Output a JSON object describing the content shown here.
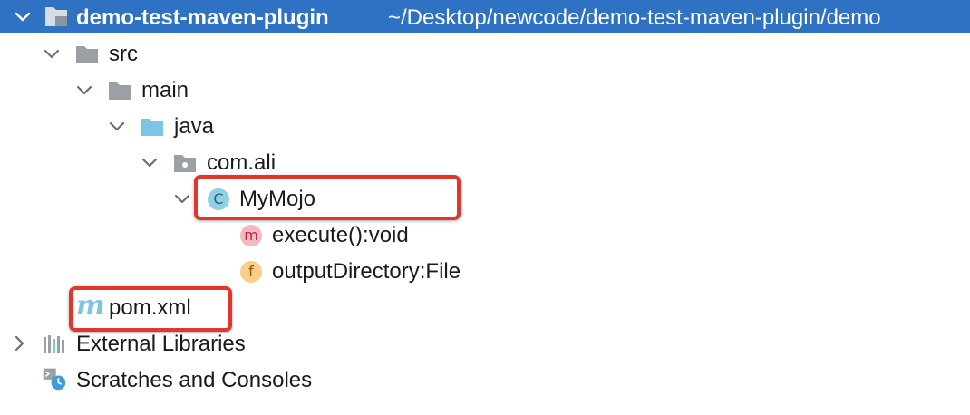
{
  "project": {
    "name": "demo-test-maven-plugin",
    "path": "~/Desktop/newcode/demo-test-maven-plugin/demo"
  },
  "tree": {
    "src": "src",
    "main": "main",
    "java": "java",
    "package": "com.ali",
    "class": "MyMojo",
    "class_badge": "C",
    "method": "execute():void",
    "method_badge": "m",
    "field": "outputDirectory:File",
    "field_badge": "f",
    "pom": "pom.xml",
    "pom_badge": "m",
    "external_libraries": "External Libraries",
    "scratches": "Scratches and Consoles"
  },
  "colors": {
    "selection": "#2f72c4",
    "highlight_box": "#e2362c",
    "folder": "#9aa0a6",
    "source_folder": "#7cc5e3"
  }
}
